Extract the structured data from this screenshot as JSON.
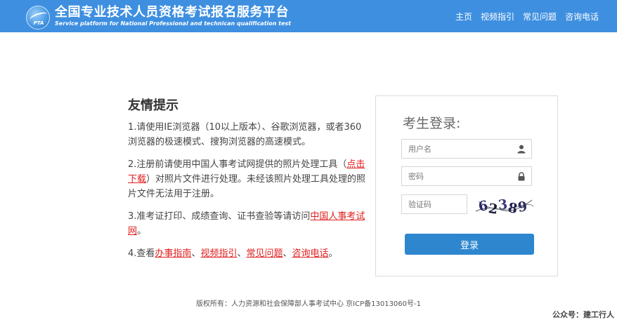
{
  "header": {
    "logo_text": "PTA",
    "title": "全国专业技术人员资格考试报名服务平台",
    "subtitle": "Service platform for National Professional and technican qualification test",
    "nav": [
      "主页",
      "视频指引",
      "常见问题",
      "咨询电话"
    ]
  },
  "tips": {
    "title": "友情提示",
    "tip1": "1.请使用IE浏览器（10以上版本）、谷歌浏览器，或者360浏览器的极速模式、搜狗浏览器的高速模式。",
    "tip2_before": "2.注册前请使用中国人事考试网提供的照片处理工具（",
    "tip2_link": "点击下载",
    "tip2_after": "）对照片文件进行处理。未经该照片处理工具处理的照片文件无法用于注册。",
    "tip3_before": "3.准考证打印、成绩查询、证书查验等请访问",
    "tip3_link": "中国人事考试网",
    "tip3_after": "。",
    "tip4_before": "4.查看",
    "tip4_links": [
      "办事指南",
      "视频指引",
      "常见问题",
      "咨询电话"
    ],
    "tip4_sep": "、",
    "tip4_after": "。"
  },
  "login": {
    "title": "考生登录:",
    "username_placeholder": "用户名",
    "password_placeholder": "密码",
    "captcha_placeholder": "验证码",
    "captcha_chars": [
      "6",
      "2",
      "3",
      "8",
      "9"
    ],
    "captcha_colors": [
      "#2a2a6a",
      "#1a1a3a",
      "#3a3a7a",
      "#202050",
      "#2a2a5a"
    ],
    "button": "登录"
  },
  "footer": {
    "copyright": "版权所有：人力资源和社会保障部人事考试中心 京ICP备13013060号-1"
  },
  "watermark": "公众号：建工行人",
  "colors": {
    "header_bg": "#3e8fe0",
    "button_bg": "#2e86cf",
    "link_red": "#e02020"
  }
}
